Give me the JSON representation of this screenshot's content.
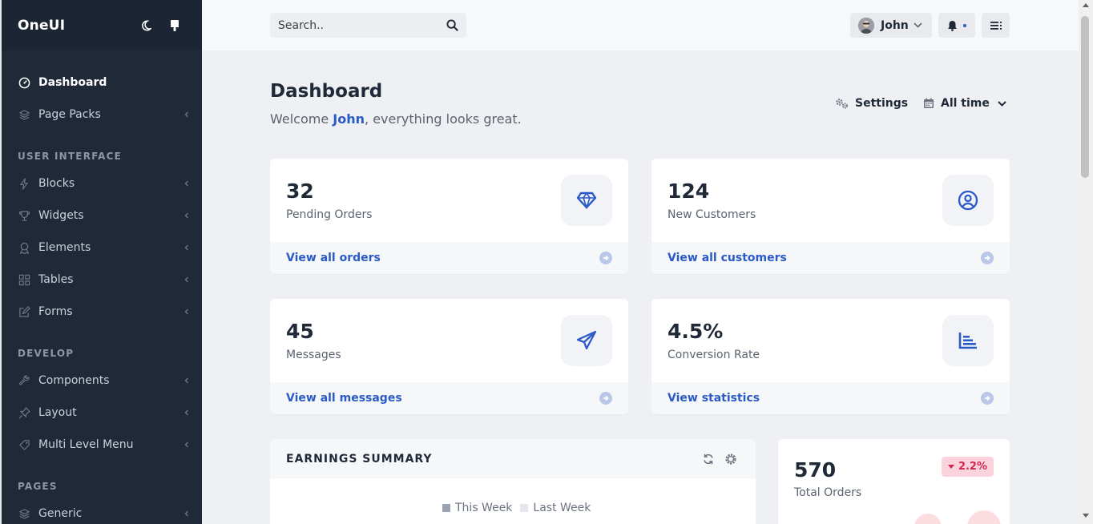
{
  "app": {
    "brand": "OneUI"
  },
  "sidebar": {
    "items": [
      {
        "type": "item",
        "label": "Dashboard",
        "icon": "dashboard-icon",
        "active": true
      },
      {
        "type": "item",
        "label": "Page Packs",
        "icon": "layers-icon",
        "chevron": true
      },
      {
        "type": "heading",
        "label": "USER INTERFACE"
      },
      {
        "type": "item",
        "label": "Blocks",
        "icon": "bolt-icon",
        "chevron": true
      },
      {
        "type": "item",
        "label": "Widgets",
        "icon": "trophy-icon",
        "chevron": true
      },
      {
        "type": "item",
        "label": "Elements",
        "icon": "badge-icon",
        "chevron": true
      },
      {
        "type": "item",
        "label": "Tables",
        "icon": "grid-icon",
        "chevron": true
      },
      {
        "type": "item",
        "label": "Forms",
        "icon": "edit-icon",
        "chevron": true
      },
      {
        "type": "heading",
        "label": "DEVELOP"
      },
      {
        "type": "item",
        "label": "Components",
        "icon": "wrench-icon",
        "chevron": true
      },
      {
        "type": "item",
        "label": "Layout",
        "icon": "pin-icon",
        "chevron": true
      },
      {
        "type": "item",
        "label": "Multi Level Menu",
        "icon": "tag-icon",
        "chevron": true
      },
      {
        "type": "heading",
        "label": "PAGES"
      },
      {
        "type": "item",
        "label": "Generic",
        "icon": "layers-icon",
        "chevron": true
      }
    ]
  },
  "topbar": {
    "search_placeholder": "Search..",
    "user_name": "John"
  },
  "page": {
    "title": "Dashboard",
    "welcome_prefix": "Welcome ",
    "welcome_name": "John",
    "welcome_suffix": ", everything looks great.",
    "settings_label": "Settings",
    "range_label": "All time"
  },
  "stats": [
    {
      "value": "32",
      "label": "Pending Orders",
      "link": "View all orders",
      "icon": "diamond-icon"
    },
    {
      "value": "124",
      "label": "New Customers",
      "link": "View all customers",
      "icon": "user-circle-icon"
    },
    {
      "value": "45",
      "label": "Messages",
      "link": "View all messages",
      "icon": "paper-plane-icon"
    },
    {
      "value": "4.5%",
      "label": "Conversion Rate",
      "link": "View statistics",
      "icon": "bar-chart-icon"
    }
  ],
  "earnings": {
    "title": "EARNINGS SUMMARY",
    "legend": [
      "This Week",
      "Last Week"
    ],
    "colors": {
      "this_week": "#9aa3b1",
      "last_week": "#e3e6ea"
    }
  },
  "orders": {
    "value": "570",
    "label": "Total Orders",
    "badge": "2.2%"
  },
  "colors": {
    "accent": "#2a5ac8",
    "sidebar": "#1f2937",
    "danger": "#d4264e"
  }
}
